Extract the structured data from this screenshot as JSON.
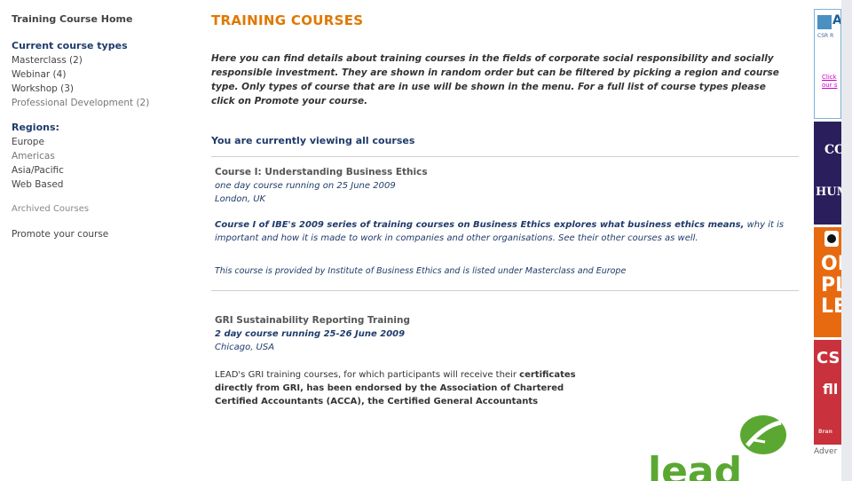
{
  "sidebar": {
    "home": "Training Course Home",
    "course_types_title": "Current course types",
    "course_types": [
      "Masterclass (2)",
      "Webinar (4)",
      "Workshop (3)",
      "Professional Development (2)"
    ],
    "regions_title": "Regions:",
    "regions": [
      "Europe",
      "Americas",
      "Asia/Pacific",
      "Web Based"
    ],
    "archived": "Archived Courses",
    "promote": "Promote your course"
  },
  "main": {
    "title": "TRAINING COURSES",
    "intro": "Here you can find details about training courses in the fields of corporate social responsibility and socially responsible investment. They are shown in random order but can be filtered by picking a region and course type. Only types of course that are in use will be shown in the menu. For a full list of course types please click on Promote your course.",
    "viewing": "You are currently viewing all courses",
    "courses": [
      {
        "title": "Course I: Understanding Business Ethics",
        "when": "one day course running on 25 June 2009",
        "where": "London, UK",
        "desc_lead": "Course I of IBE's 2009 series of training courses on Business Ethics explores what business ethics means,",
        "desc_rest": "why it is important and how it is made to work in companies and other organisations. See their other courses as well.",
        "provided": "This course is provided by Institute of Business Ethics and is listed under Masterclass and Europe"
      },
      {
        "title": "GRI Sustainability Reporting Training",
        "when": "2 day course running 25-26 June 2009",
        "where": "Chicago, USA",
        "desc_a": "LEAD's GRI training courses, for which participants will receive their",
        "desc_b": "certificates directly from GRI, has been endorsed by the Association of Chartered Certified Accountants (ACCA), the Certified General Accountants",
        "logo_text": "lead"
      }
    ]
  },
  "ads": {
    "ad1_logo": "A",
    "ad1_sub": "CSR R",
    "ad1_click": "Click our s",
    "ad2_line1": "CO",
    "ad2_line2": "HUM",
    "ad3_text": "ON PL LE",
    "ad4_line1": "CSR",
    "ad4_line2": "fll",
    "ad4_line3": "Bran",
    "label": "Adver"
  },
  "colors": {
    "accent_orange": "#e07800",
    "nav_blue": "#1f3b6b",
    "lead_green": "#5aa832"
  }
}
